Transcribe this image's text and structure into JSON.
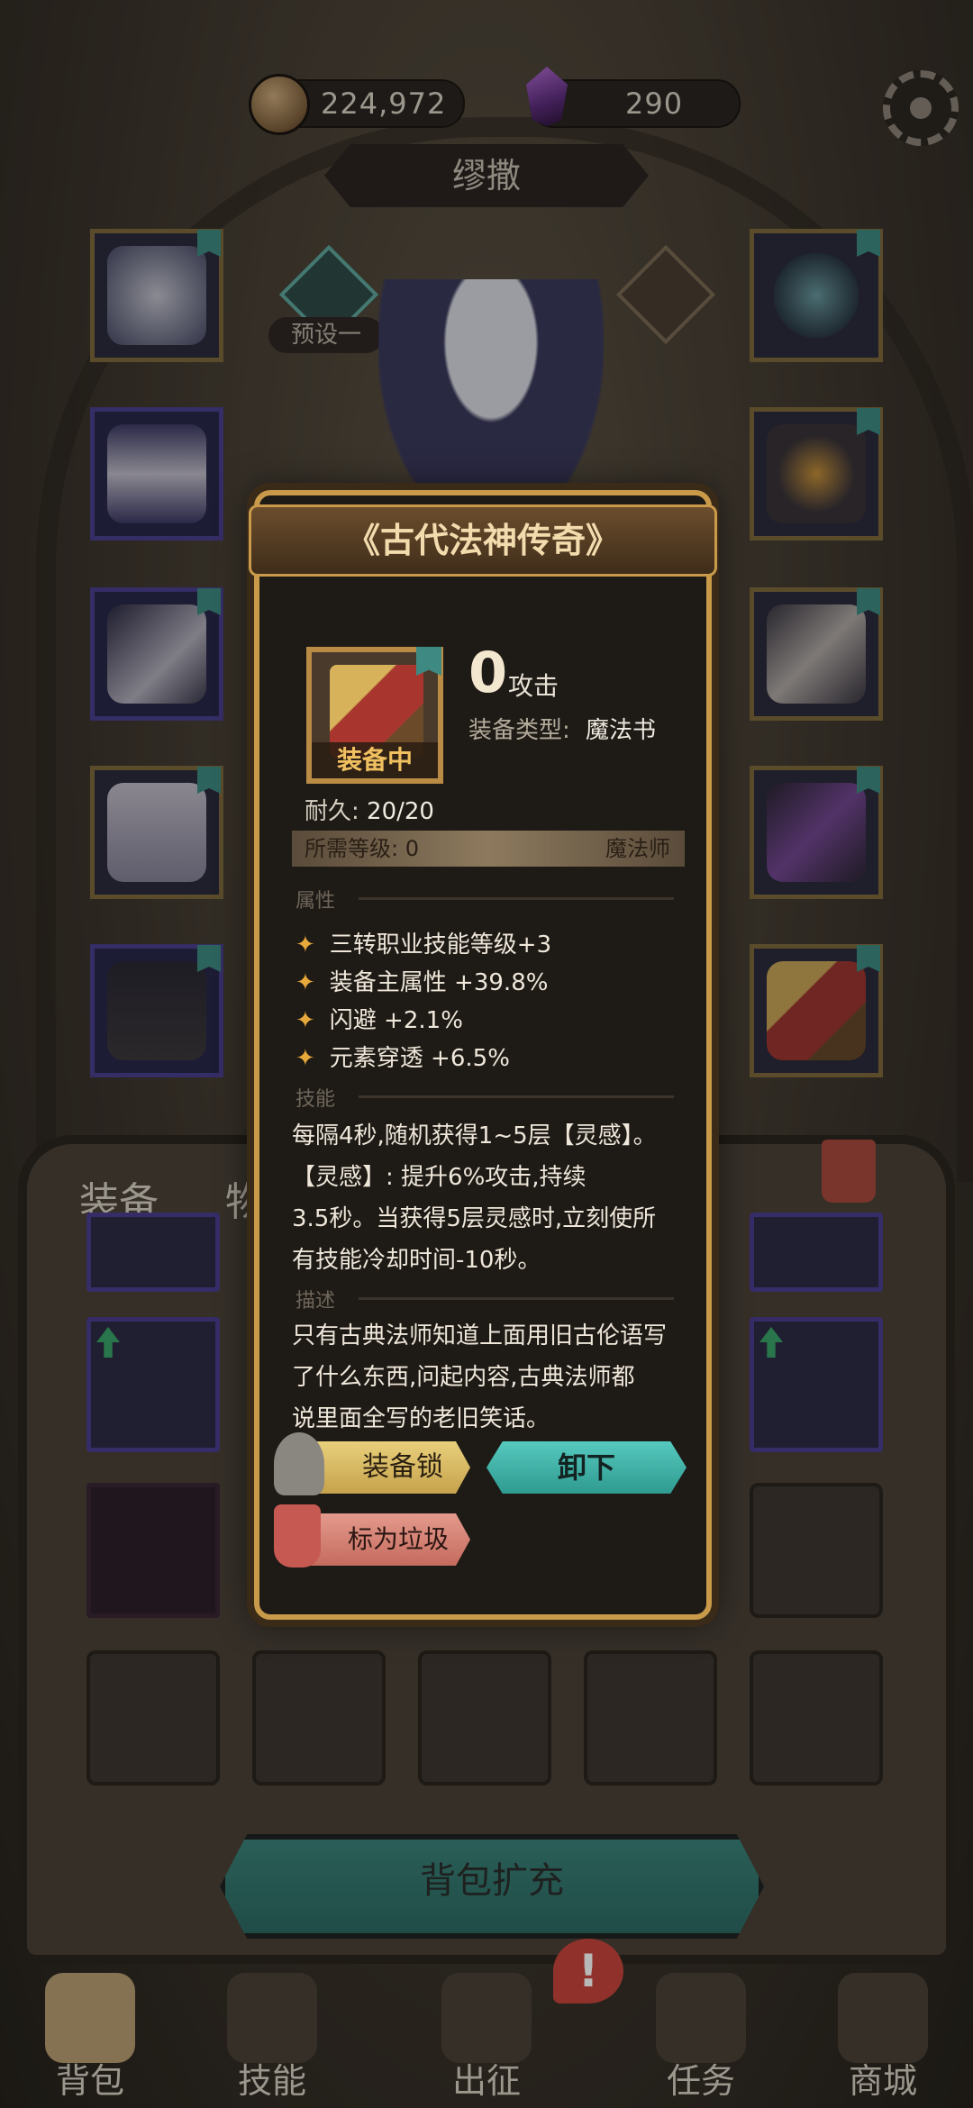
{
  "currency": {
    "gold": "224,972",
    "gems": "290"
  },
  "character_name": "缪撒",
  "preset_label": "预设一",
  "tabs": {
    "equipment": "装备",
    "items_partial": "物品"
  },
  "expand_button": "背包扩充",
  "nav": [
    {
      "label": "背包"
    },
    {
      "label": "技能"
    },
    {
      "label": "出征"
    },
    {
      "label": "任务"
    },
    {
      "label": "商城"
    }
  ],
  "alert_badge": "!",
  "popup": {
    "title": "《古代法神传奇》",
    "equipped_banner": "装备中",
    "attack_value": "0",
    "attack_label": "攻击",
    "type_label": "装备类型:",
    "type_value": "魔法书",
    "durability_label": "耐久:",
    "durability_value": "20/20",
    "required_level": "所需等级: 0",
    "class": "魔法师",
    "section_attr": "属性",
    "attributes": [
      "三转职业技能等级+3",
      "装备主属性 +39.8%",
      "闪避 +2.1%",
      "元素穿透 +6.5%"
    ],
    "section_skill": "技能",
    "skill_lines": [
      "每隔4秒,随机获得1~5层【灵感】。",
      "【灵感】: 提升6%攻击,持续",
      "3.5秒。当获得5层灵感时,立刻使所",
      "有技能冷却时间-10秒。"
    ],
    "section_desc": "描述",
    "desc_lines": [
      "只有古典法师知道上面用旧古伦语写",
      "了什么东西,问起内容,古典法师都",
      "说里面全写的老旧笑话。"
    ],
    "lock_button": "装备锁",
    "unequip_button": "卸下",
    "junk_button": "标为垃圾"
  }
}
